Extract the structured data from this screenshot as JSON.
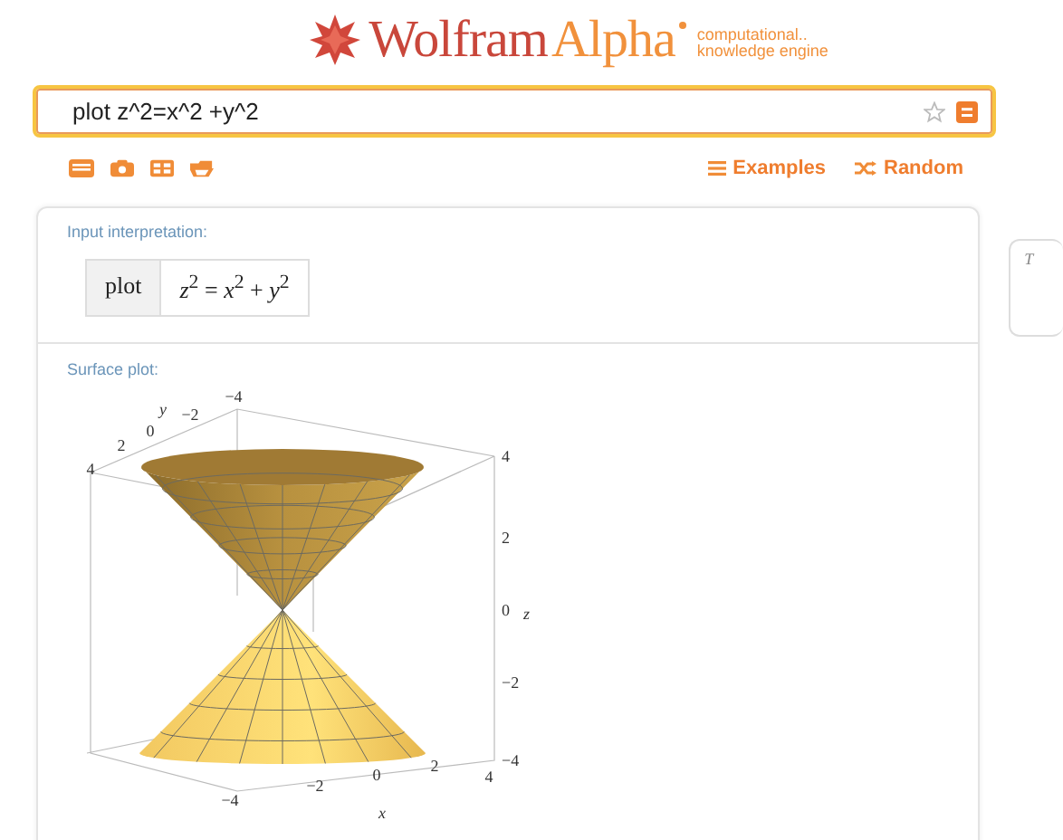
{
  "logo": {
    "word_1": "Wolfram",
    "word_2": "Alpha",
    "tagline": [
      "computational..",
      "knowledge engine"
    ]
  },
  "search": {
    "value": "plot z^2=x^2 +y^2",
    "favorite": false
  },
  "tools": {
    "links": [
      {
        "label": "Examples",
        "kind": "examples"
      },
      {
        "label": "Random",
        "kind": "random"
      }
    ]
  },
  "pods": [
    {
      "title": "Input interpretation:",
      "kind": "interpretation",
      "cells": [
        "plot"
      ],
      "formula": "*z*$^{2}$ = *x*$^{2}$ + *y*$^{2}$"
    },
    {
      "title": "Surface plot:",
      "kind": "plot",
      "y_axis": {
        "name": "y",
        "ticks": [
          "4",
          "2",
          "0",
          "−2",
          "−4"
        ]
      },
      "z_axis": {
        "name": "z",
        "ticks": [
          "4",
          "2",
          "0",
          "−2",
          "−4"
        ]
      },
      "x_axis": {
        "name": "x",
        "ticks": [
          "−4",
          "−2",
          "0",
          "2",
          "4"
        ]
      }
    }
  ],
  "side_card": {
    "text": "T"
  }
}
